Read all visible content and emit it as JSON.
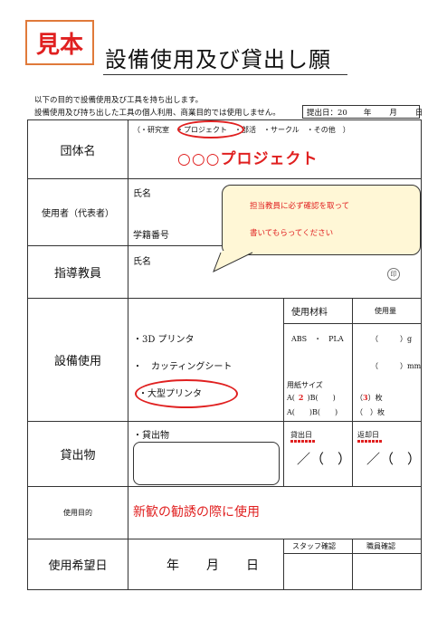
{
  "header": {
    "sample_stamp": "見本",
    "title": "設備使用及び貸出し願",
    "intro_line1": "以下の目的で設備使用及び工具を持ち出します。",
    "intro_line2": "設備使用及び持ち出した工具の個人利用、商業目的では使用しません。",
    "date_label": "提出日：20",
    "date_year": "年",
    "date_month": "月",
    "date_day": "日"
  },
  "group": {
    "label": "団体名",
    "options": "（・研究室　・プロジェクト　・部活　・サークル　・その他　）",
    "value": "○○○プロジェクト"
  },
  "user": {
    "label": "使用者（代表者）",
    "name_label": "氏名",
    "id_label": "学籍番号"
  },
  "bubble": {
    "line1": "担当教員に必ず確認を取って",
    "line2": "書いてもらってください"
  },
  "advisor": {
    "label": "指導教員",
    "name_label": "氏名",
    "seal": "印"
  },
  "equipment": {
    "label": "設備使用",
    "items": [
      "・3D プリンタ",
      "・　カッティングシート",
      "・大型プリンタ"
    ],
    "material_header": "使用材料",
    "amount_header": "使用量",
    "material_abs": "ABS　・　PLA",
    "amount_g": "（　　　）g",
    "amount_mm": "（　　　）mm",
    "paper_label": "用紙サイズ",
    "paper_a_prefix": "A(",
    "paper_a_value": "2",
    "paper_a_suffix": ")B(　　)",
    "paper_a2": "A(　　)B(　　)",
    "count1_prefix": "（",
    "count1_value": "3",
    "count1_suffix": "）枚",
    "count2": "（　）枚"
  },
  "lending": {
    "label": "貸出物",
    "item_label": "・貸出物",
    "out_date_label": "貸出日",
    "return_date_label": "返却日",
    "out_date_format": "／（　）",
    "return_date_format": "／（　）"
  },
  "purpose": {
    "label": "使用目的",
    "value": "新歓の勧誘の際に使用"
  },
  "desired_date": {
    "label": "使用希望日",
    "year": "年",
    "month": "月",
    "day": "日",
    "staff_check": "スタッフ確認",
    "staff_member_check": "職員確認"
  }
}
